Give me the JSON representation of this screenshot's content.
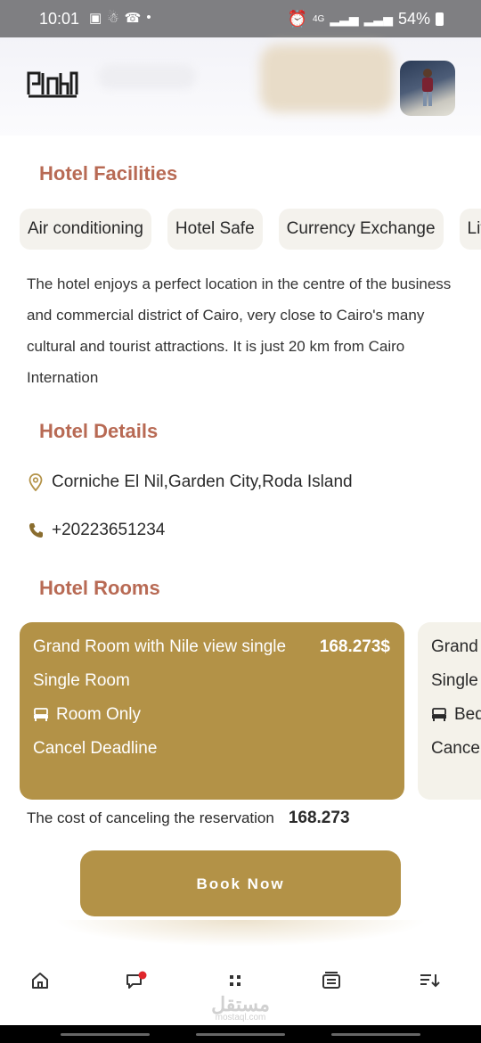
{
  "status_bar": {
    "time": "10:01",
    "dot": "•",
    "network": "4G",
    "battery": "54%"
  },
  "facilities": {
    "title": "Hotel Facilities",
    "chips": [
      "Air conditioning",
      "Hotel Safe",
      "Currency Exchange",
      "Lifts"
    ]
  },
  "description": "The hotel enjoys a perfect location in the centre of the business and commercial district of Cairo, very close to Cairo's many cultural and tourist attractions. It is just 20 km from Cairo Internation",
  "details": {
    "title": "Hotel Details",
    "address": "Corniche El Nil,Garden City,Roda Island",
    "phone": "+20223651234"
  },
  "rooms": {
    "title": "Hotel Rooms",
    "cards": [
      {
        "name": "Grand Room with Nile view single",
        "price": "168.273$",
        "type": "Single Room",
        "board": "Room Only",
        "cancel": "Cancel Deadline"
      },
      {
        "name": "Grand",
        "type": "Single",
        "board": "Bed",
        "cancel": "Cancel"
      }
    ]
  },
  "cancellation": {
    "label": "The cost of canceling the reservation",
    "value": "168.273"
  },
  "book_button": "Book Now",
  "bottom_nav": [
    "home-icon",
    "chat-icon",
    "grid-icon",
    "list-icon",
    "sort-icon"
  ],
  "watermark": {
    "arabic": "مستقل",
    "latin": "mostaql.com"
  },
  "colors": {
    "accent": "#b39247",
    "title": "#b86a54",
    "chip_bg": "#f4f2ed",
    "notification": "#e0262b"
  }
}
